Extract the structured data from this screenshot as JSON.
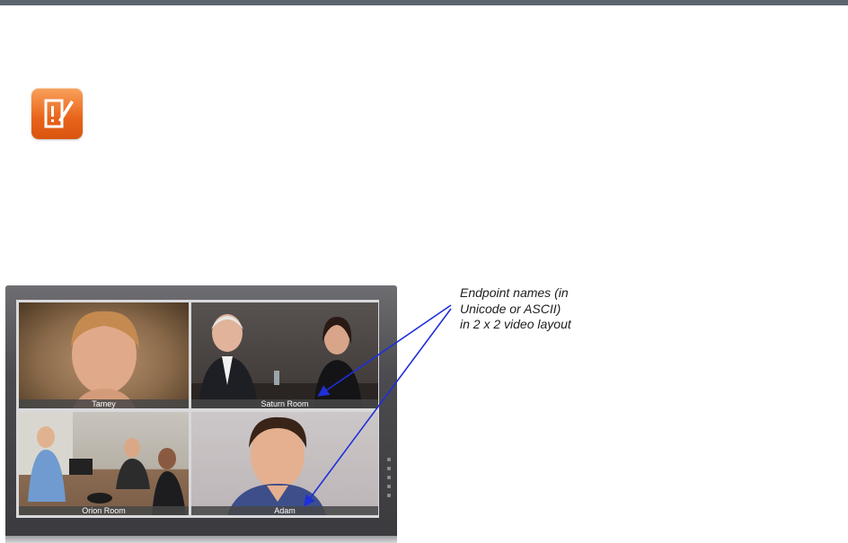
{
  "callout": {
    "line1": "Endpoint names (in",
    "line2": "Unicode or ASCII)",
    "line3": "in 2 x 2 video layout"
  },
  "tiles": [
    {
      "label": "Tamey",
      "active": true
    },
    {
      "label": "Saturn Room",
      "active": false
    },
    {
      "label": "Orion Room",
      "active": false
    },
    {
      "label": "Adam",
      "active": false
    }
  ],
  "icons": {
    "note": "note-icon"
  },
  "colors": {
    "top_rule": "#5b6570",
    "note_icon": "#e8631a",
    "active_speaker_border": "#f3ec19",
    "callout_arrow": "#1f2fd8"
  }
}
